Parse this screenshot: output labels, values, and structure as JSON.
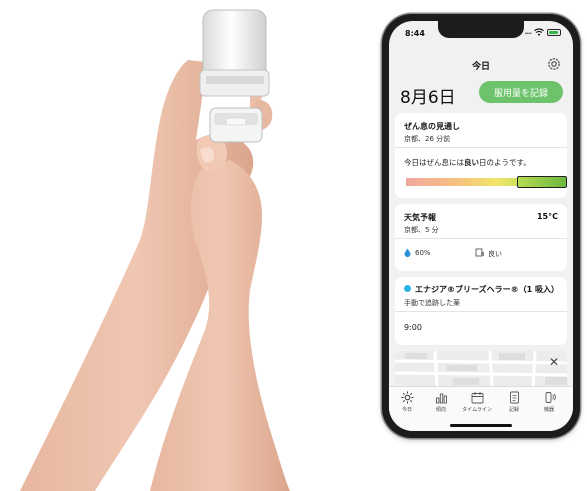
{
  "status_bar": {
    "time": "8:44",
    "dots": "...."
  },
  "header": {
    "title": "今日"
  },
  "date": "8月6日",
  "record_button": "服用量を記録",
  "asthma_card": {
    "title": "ぜん息の見通し",
    "meta": "京都、26 分前",
    "message_prefix": "今日はぜん息には",
    "message_em": "良い",
    "message_suffix": "日のようです。",
    "level_fraction": 0.85
  },
  "weather_card": {
    "title": "天気予報",
    "temperature": "15°C",
    "meta": "京都、5 分",
    "humidity": "60%",
    "air_quality": "良い"
  },
  "medication_card": {
    "title": "エナジア®ブリーズヘラー®（1 吸入）",
    "subtitle": "手動で追跡した薬",
    "time": "9:00"
  },
  "tabbar": {
    "items": [
      {
        "label": "今日",
        "icon": "sun-icon"
      },
      {
        "label": "傾向",
        "icon": "bar-chart-icon"
      },
      {
        "label": "タイムライン",
        "icon": "calendar-icon"
      },
      {
        "label": "記録",
        "icon": "document-icon"
      },
      {
        "label": "機器",
        "icon": "inhaler-icon"
      }
    ]
  },
  "colors": {
    "accent": "#6cc36b",
    "medication_dot": "#2ab3e6",
    "humidity_icon": "#2a8fd8"
  }
}
